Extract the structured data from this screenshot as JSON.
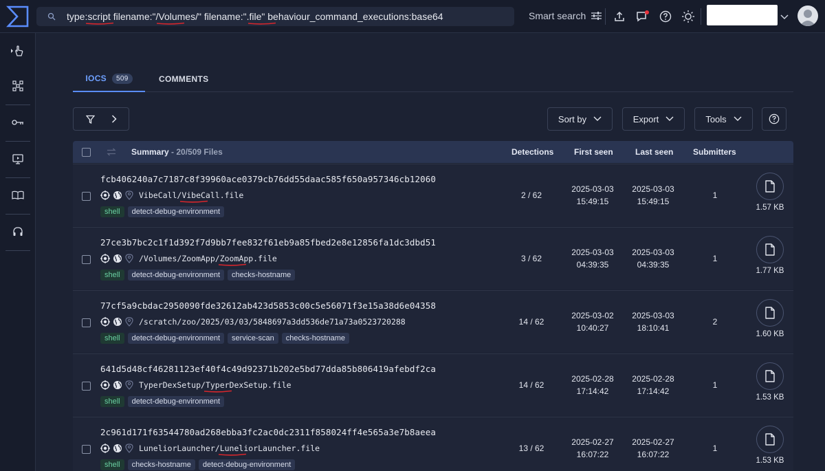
{
  "app": {
    "search_query_parts": [
      "type:",
      "script",
      " filename:\"/",
      "Volumes",
      "/\" filename:\".",
      "file",
      "\" behaviour_command_executions:base64"
    ],
    "smart_search_label": "Smart search",
    "accent": "#5a8dff"
  },
  "tabs": [
    {
      "label": "IOCS",
      "count": "509",
      "active": true
    },
    {
      "label": "COMMENTS",
      "active": false
    }
  ],
  "toolbar": {
    "sort_label": "Sort by",
    "export_label": "Export",
    "tools_label": "Tools"
  },
  "table": {
    "summary_label": "Summary",
    "summary_count": " - 20/509 Files",
    "col_detections": "Detections",
    "col_first_seen": "First seen",
    "col_last_seen": "Last seen",
    "col_submitters": "Submitters",
    "rows": [
      {
        "hash": "fcb406240a7c7187c8f39960ace0379cb76dd55daac585f650a957346cb12060",
        "path_prefix": "VibeCall/",
        "path_file": "VibeCall.file",
        "tags": [
          "shell",
          "detect-debug-environment"
        ],
        "detections": "2 / 62",
        "first_date": "2025-03-03",
        "first_time": "15:49:15",
        "last_date": "2025-03-03",
        "last_time": "15:49:15",
        "submitters": "1",
        "size": "1.57 KB"
      },
      {
        "hash": "27ce3b7bc2c1f1d392f7d9bb7fee832f61eb9a85fbed2e8e12856fa1dc3dbd51",
        "path_prefix": "/Volumes/ZoomApp/",
        "path_file": "ZoomApp.file",
        "tags": [
          "shell",
          "detect-debug-environment",
          "checks-hostname"
        ],
        "detections": "3 / 62",
        "first_date": "2025-03-03",
        "first_time": "04:39:35",
        "last_date": "2025-03-03",
        "last_time": "04:39:35",
        "submitters": "1",
        "size": "1.77 KB"
      },
      {
        "hash": "77cf5a9cbdac2950090fde32612ab423d5853c00c5e56071f3e15a38d6e04358",
        "path_prefix": "/scratch/zoo/2025/03/03/5848697a3dd536de71a73a0523720288",
        "path_file": "",
        "tags": [
          "shell",
          "detect-debug-environment",
          "service-scan",
          "checks-hostname"
        ],
        "detections": "14 / 62",
        "first_date": "2025-03-02",
        "first_time": "10:40:27",
        "last_date": "2025-03-03",
        "last_time": "18:10:41",
        "submitters": "2",
        "size": "1.60 KB"
      },
      {
        "hash": "641d5d48cf46281123ef40f4c49d92371b202e5bd77dda85b806419afebdf2ca",
        "path_prefix": "TyperDexSetup/",
        "path_file": "TyperDexSetup.file",
        "tags": [
          "shell",
          "detect-debug-environment"
        ],
        "detections": "14 / 62",
        "first_date": "2025-02-28",
        "first_time": "17:14:42",
        "last_date": "2025-02-28",
        "last_time": "17:14:42",
        "submitters": "1",
        "size": "1.53 KB"
      },
      {
        "hash": "2c961d171f63544780ad268ebba3fc2ac0dc2311f858024ff4e565a3e7b8aeea",
        "path_prefix": "LuneliorLauncher/",
        "path_file": "LuneliorLauncher.file",
        "tags": [
          "shell",
          "checks-hostname",
          "detect-debug-environment"
        ],
        "detections": "13 / 62",
        "first_date": "2025-02-27",
        "first_time": "16:07:22",
        "last_date": "2025-02-27",
        "last_time": "16:07:22",
        "submitters": "1",
        "size": "1.53 KB"
      }
    ]
  }
}
